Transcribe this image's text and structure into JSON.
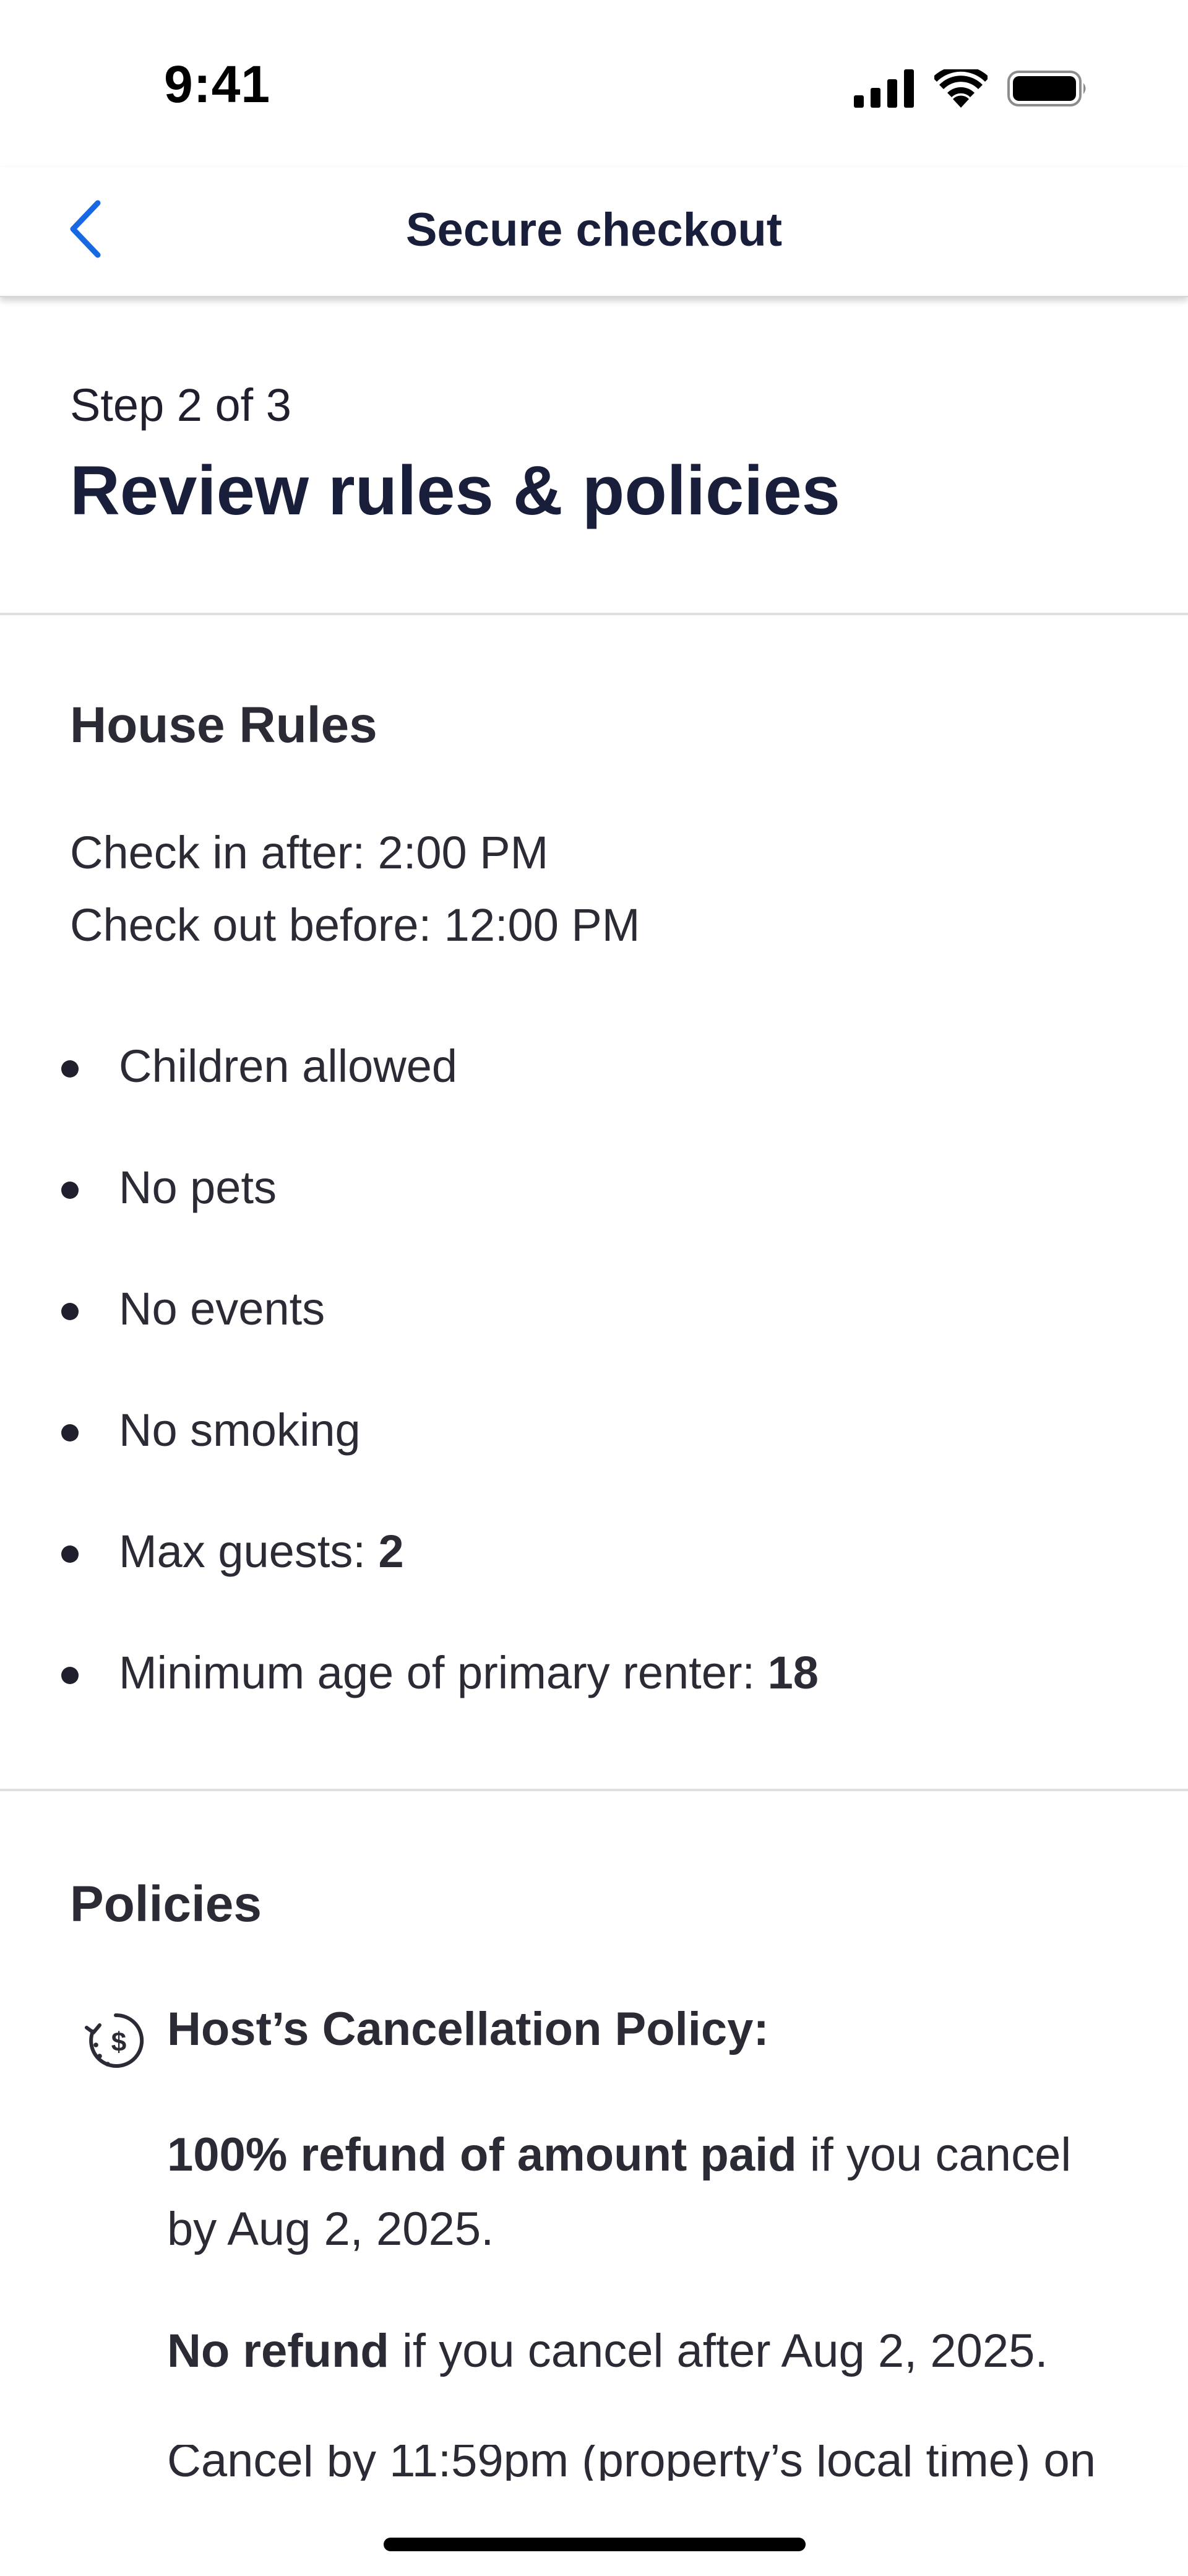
{
  "status_bar": {
    "time": "9:41",
    "icons": [
      "cellular-signal-icon",
      "wifi-icon",
      "battery-icon"
    ]
  },
  "nav": {
    "back_icon": "chevron-left-icon",
    "title": "Secure checkout"
  },
  "step": {
    "label": "Step 2 of 3",
    "title": "Review rules & policies"
  },
  "house_rules": {
    "title": "House Rules",
    "check_in": "Check in after: 2:00 PM",
    "check_out": "Check out before: 12:00 PM",
    "items": [
      {
        "text": "Children allowed",
        "value": ""
      },
      {
        "text": "No pets",
        "value": ""
      },
      {
        "text": "No events",
        "value": ""
      },
      {
        "text": "No smoking",
        "value": ""
      },
      {
        "text": "Max guests: ",
        "value": "2"
      },
      {
        "text": "Minimum age of primary renter: ",
        "value": "18"
      }
    ]
  },
  "policies": {
    "title": "Policies",
    "cancellation": {
      "icon": "refund-clock-icon",
      "heading": "Host’s Cancellation Policy:",
      "full_refund_bold": "100% refund of amount paid",
      "full_refund_rest": " if you cancel by Aug 2, 2025.",
      "no_refund_bold": "No refund",
      "no_refund_rest": " if you cancel after Aug 2, 2025.",
      "cut_off_line": "Cancel by 11:59pm (property’s local time) on"
    }
  },
  "colors": {
    "accent": "#1668e3",
    "heading": "#191e3b",
    "text": "#2b2b35",
    "divider": "#dedee3"
  }
}
